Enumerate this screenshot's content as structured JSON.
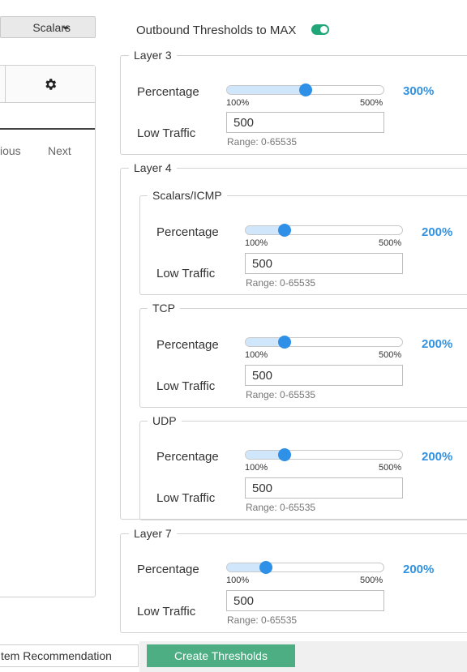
{
  "left": {
    "scalars_button": "Scalars",
    "pager_prev": "ious",
    "pager_next": "Next",
    "system_recommendation": "tem Recommendation"
  },
  "footer": {
    "create_thresholds": "Create Thresholds"
  },
  "outbound": {
    "label": "Outbound Thresholds to MAX",
    "enabled": true
  },
  "layer3": {
    "legend": "Layer 3",
    "percentage_label": "Percentage",
    "min_label": "100%",
    "max_label": "500%",
    "value_label": "300%",
    "value": 300,
    "low_traffic_label": "Low Traffic",
    "low_traffic_value": "500",
    "range": "Range: 0-65535"
  },
  "layer4": {
    "legend": "Layer 4",
    "scalars_icmp": {
      "legend": "Scalars/ICMP",
      "percentage_label": "Percentage",
      "min_label": "100%",
      "max_label": "500%",
      "value_label": "200%",
      "value": 200,
      "low_traffic_label": "Low Traffic",
      "low_traffic_value": "500",
      "range": "Range: 0-65535"
    },
    "tcp": {
      "legend": "TCP",
      "percentage_label": "Percentage",
      "min_label": "100%",
      "max_label": "500%",
      "value_label": "200%",
      "value": 200,
      "low_traffic_label": "Low Traffic",
      "low_traffic_value": "500",
      "range": "Range: 0-65535"
    },
    "udp": {
      "legend": "UDP",
      "percentage_label": "Percentage",
      "min_label": "100%",
      "max_label": "500%",
      "value_label": "200%",
      "value": 200,
      "low_traffic_label": "Low Traffic",
      "low_traffic_value": "500",
      "range": "Range: 0-65535"
    }
  },
  "layer7": {
    "legend": "Layer 7",
    "percentage_label": "Percentage",
    "min_label": "100%",
    "max_label": "500%",
    "value_label": "200%",
    "value": 200,
    "low_traffic_label": "Low Traffic",
    "low_traffic_value": "500",
    "range": "Range: 0-65535"
  },
  "colors": {
    "accent": "#3292e0",
    "toggle": "#21a67a",
    "primary_button": "#4cae82"
  }
}
